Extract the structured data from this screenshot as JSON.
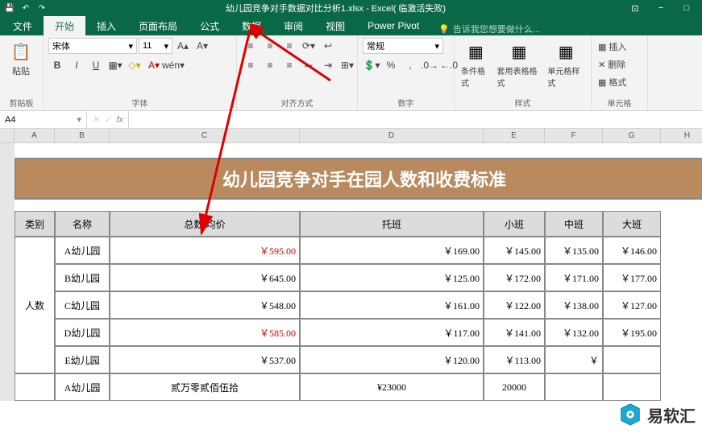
{
  "titlebar": {
    "title": "幼儿园竞争对手数据对比分析1.xlsx - Excel( 临激活失败)"
  },
  "tabs": {
    "file": "文件",
    "home": "开始",
    "insert": "插入",
    "layout": "页面布局",
    "formula": "公式",
    "data": "数据",
    "review": "审阅",
    "view": "视图",
    "powerpivot": "Power Pivot",
    "tellme": "告诉我您想要做什么..."
  },
  "ribbon": {
    "paste": "粘贴",
    "clipboard_label": "剪贴板",
    "font_name": "宋体",
    "font_size": "11",
    "font_label": "字体",
    "align_label": "对齐方式",
    "number_format": "常规",
    "number_label": "数字",
    "cond_fmt": "条件格式",
    "table_fmt": "套用表格格式",
    "cell_style": "单元格样式",
    "styles_label": "样式",
    "insert_btn": "插入",
    "delete_btn": "删除",
    "format_btn": "格式",
    "cells_label": "单元格"
  },
  "formula": {
    "name_box": "A4",
    "fx": "fx"
  },
  "cols": [
    "",
    "A",
    "B",
    "C",
    "D",
    "E",
    "F",
    "G",
    "H"
  ],
  "banner": "幼儿园竞争对手在园人数和收费标准",
  "headers": {
    "category": "类别",
    "name": "名称",
    "total": "总数/均价",
    "tuoban": "托班",
    "xiaoban": "小班",
    "zhongban": "中班",
    "daban": "大班"
  },
  "category_label": "人数",
  "rows": [
    {
      "name": "A幼儿园",
      "total": "￥595.00",
      "total_red": true,
      "c1": "￥169.00",
      "c2": "￥145.00",
      "c3": "￥135.00",
      "c4": "￥146.00"
    },
    {
      "name": "B幼儿园",
      "total": "￥645.00",
      "total_red": false,
      "c1": "￥125.00",
      "c2": "￥172.00",
      "c3": "￥171.00",
      "c4": "￥177.00"
    },
    {
      "name": "C幼儿园",
      "total": "￥548.00",
      "total_red": false,
      "c1": "￥161.00",
      "c2": "￥122.00",
      "c3": "￥138.00",
      "c4": "￥127.00"
    },
    {
      "name": "D幼儿园",
      "total": "￥585.00",
      "total_red": true,
      "c1": "￥117.00",
      "c2": "￥141.00",
      "c3": "￥132.00",
      "c4": "￥195.00"
    },
    {
      "name": "E幼儿园",
      "total": "￥537.00",
      "total_red": false,
      "c1": "￥120.00",
      "c2": "￥113.00",
      "c3": "￥",
      "c4": ""
    },
    {
      "name": "A幼儿园",
      "total": "贰万零贰佰伍拾",
      "total_red": false,
      "c1": "¥23000",
      "c2": "20000",
      "c3": "",
      "c4": ""
    }
  ],
  "watermark": "易软汇"
}
